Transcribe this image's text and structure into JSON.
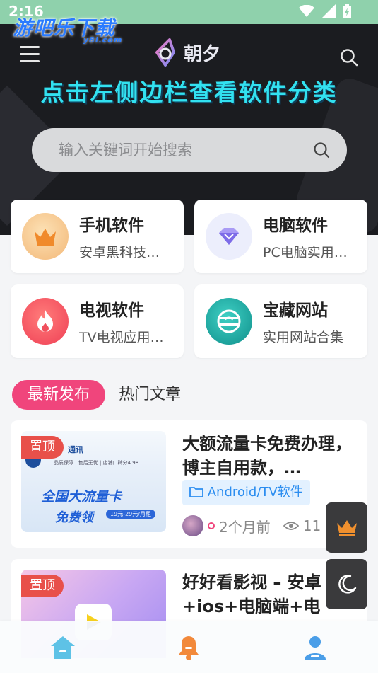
{
  "status_bar": {
    "time": "2:16"
  },
  "watermark": {
    "title": "游吧乐下载",
    "domain": "y8l.com"
  },
  "header": {
    "logo_text": "朝夕",
    "banner": "点击左侧边栏查看软件分类",
    "search": {
      "placeholder": "输入关键词开始搜索"
    }
  },
  "categories": [
    {
      "title": "手机软件",
      "subtitle": "安卓黑科技…",
      "icon": "crown-icon",
      "color": "#f2b864"
    },
    {
      "title": "电脑软件",
      "subtitle": "PC电脑实用…",
      "icon": "diamond-icon",
      "color": "#8b7cf0"
    },
    {
      "title": "电视软件",
      "subtitle": "TV电视应用…",
      "icon": "flame-icon",
      "color": "#f04f5a"
    },
    {
      "title": "宝藏网站",
      "subtitle": "实用网站合集",
      "icon": "globe-icon",
      "color": "#19a7a0"
    }
  ],
  "tabs": {
    "active": "最新发布",
    "other": "热门文章"
  },
  "posts": [
    {
      "pin": "置顶",
      "title": "大额流量卡免费办理，博主自用款，…",
      "tag": "Android/TV软件",
      "time": "2个月前",
      "views": "11",
      "thumb_lines": [
        "通讯",
        "品质保障 | 售后无忧 | 店铺口碑分4.98",
        "全国大流量卡",
        "免费领",
        "19元-29元/月租"
      ]
    },
    {
      "pin": "置顶",
      "title": "好好看影视 – 安卓+ios+电脑端+电视…"
    }
  ]
}
